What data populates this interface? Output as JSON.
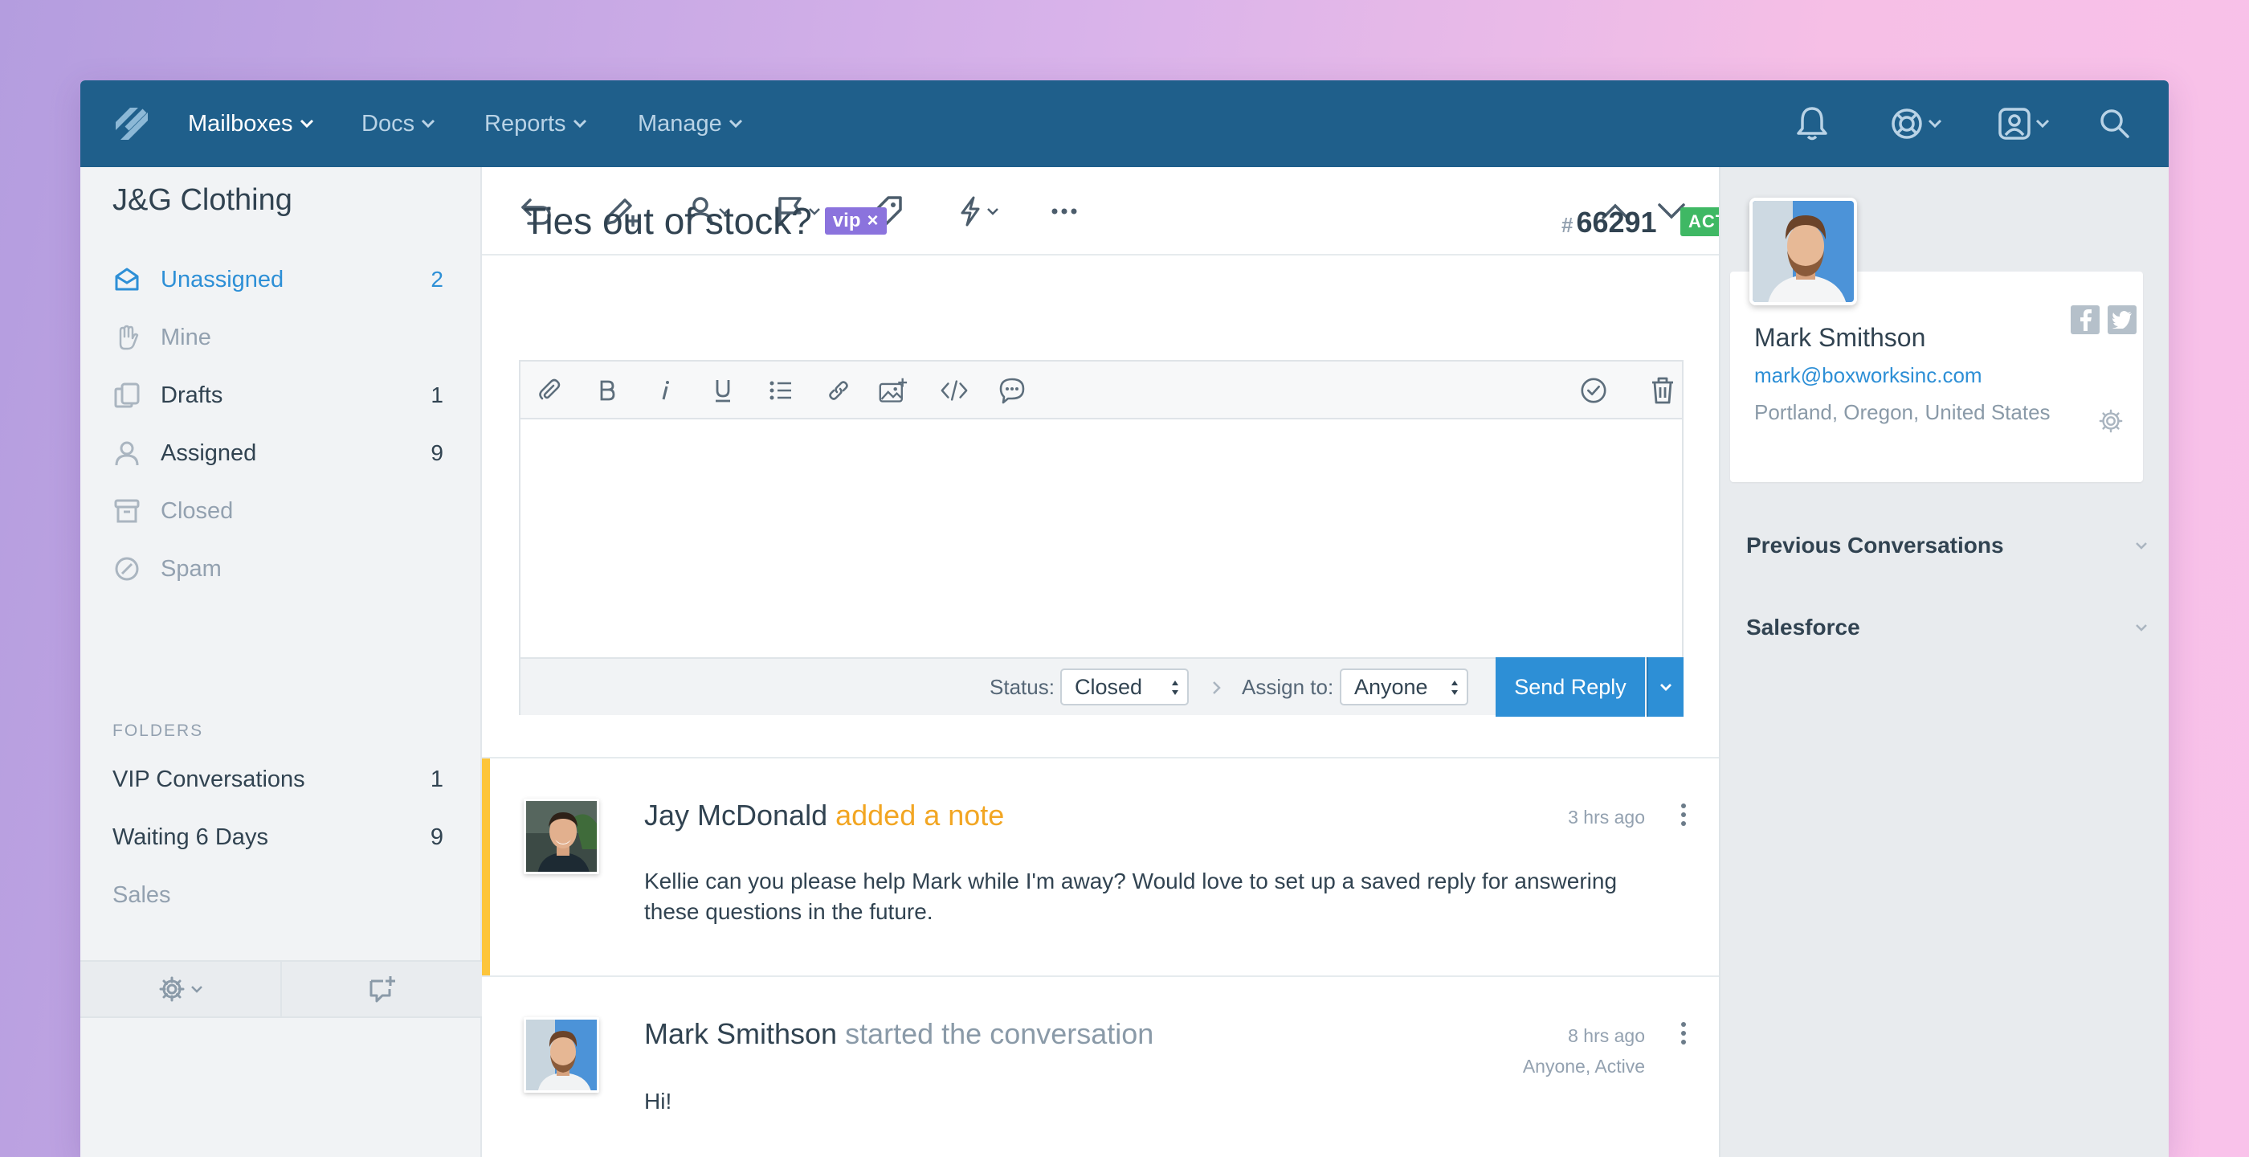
{
  "nav": {
    "items": [
      {
        "label": "Mailboxes",
        "active": true
      },
      {
        "label": "Docs",
        "active": false
      },
      {
        "label": "Reports",
        "active": false
      },
      {
        "label": "Manage",
        "active": false
      }
    ],
    "icons": [
      "bell-icon",
      "lifebuoy-icon",
      "user-account-icon",
      "search-icon"
    ]
  },
  "sidebar": {
    "title": "J&G Clothing",
    "items": [
      {
        "label": "Unassigned",
        "count": "2",
        "icon": "inbox-icon"
      },
      {
        "label": "Mine",
        "count": "",
        "icon": "hand-icon"
      },
      {
        "label": "Drafts",
        "count": "1",
        "icon": "drafts-icon"
      },
      {
        "label": "Assigned",
        "count": "9",
        "icon": "user-icon"
      },
      {
        "label": "Closed",
        "count": "",
        "icon": "archive-icon"
      },
      {
        "label": "Spam",
        "count": "",
        "icon": "block-icon"
      }
    ],
    "folders_heading": "FOLDERS",
    "folders": [
      {
        "label": "VIP Conversations",
        "count": "1"
      },
      {
        "label": "Waiting 6 Days",
        "count": "9"
      },
      {
        "label": "Sales",
        "count": ""
      }
    ]
  },
  "conversation": {
    "subject": "Ties out of stock?",
    "tag": "vip",
    "tag_remove": "×",
    "ticket_hash": "#",
    "ticket_number": "66291",
    "status_badge": "ACTIVE",
    "reply": {
      "status_label": "Status:",
      "status_value": "Closed",
      "assign_label": "Assign to:",
      "assign_value": "Anyone",
      "send_label": "Send Reply"
    },
    "thread": [
      {
        "author": "Jay McDonald",
        "action": "added a note",
        "time": "3 hrs ago",
        "meta": "",
        "body": "Kellie can you please help Mark while I'm away? Would love to set up a saved reply for answering these questions in the future."
      },
      {
        "author": "Mark Smithson",
        "action": "started the conversation",
        "time": "8 hrs ago",
        "meta": "Anyone, Active",
        "body": "Hi!"
      }
    ]
  },
  "customer": {
    "name": "Mark Smithson",
    "email": "mark@boxworksinc.com",
    "location": "Portland, Oregon, United States",
    "sections": [
      "Previous Conversations",
      "Salesforce"
    ]
  },
  "colors": {
    "nav_bg": "#1f5f8b",
    "accent": "#2d8fd6",
    "note": "#fdc53b",
    "vip": "#8b73dd",
    "active": "#3fb864"
  }
}
